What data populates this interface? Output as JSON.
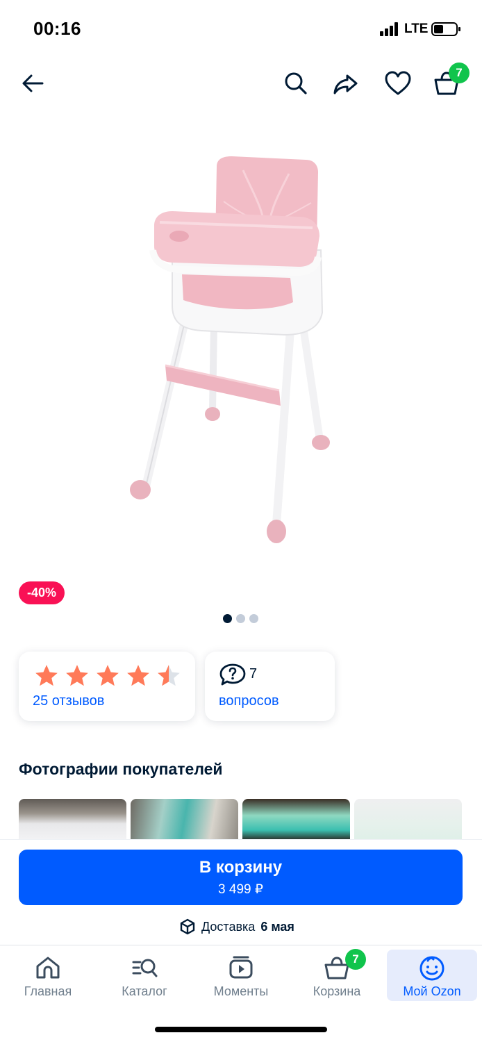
{
  "status_bar": {
    "time": "00:16",
    "network": "LTE"
  },
  "header": {
    "icons": [
      "back-arrow-icon",
      "search-icon",
      "share-icon",
      "heart-icon",
      "basket-icon"
    ],
    "cart_count": "7"
  },
  "product": {
    "image_subject": "pink baby high chair",
    "discount": "-40%",
    "gallery_total": 3,
    "gallery_active": 1
  },
  "rating_card": {
    "stars_filled": 4.5,
    "stars_max": 5,
    "star_color": "#ff7a59",
    "reviews_link": "25 отзывов"
  },
  "questions_card": {
    "count": "7",
    "link": "вопросов"
  },
  "customer_photos": {
    "title": "Фотографии покупателей",
    "count_visible": 4
  },
  "buy_panel": {
    "button_label": "В корзину",
    "price": "3 499 ₽",
    "delivery_prefix": "Доставка",
    "delivery_date": "6 мая"
  },
  "tab_bar": {
    "tabs": [
      {
        "label": "Главная",
        "icon": "home-icon"
      },
      {
        "label": "Каталог",
        "icon": "catalog-icon"
      },
      {
        "label": "Моменты",
        "icon": "moments-icon"
      },
      {
        "label": "Корзина",
        "icon": "basket-icon"
      },
      {
        "label": "Мой Ozon",
        "icon": "smiley-icon"
      }
    ],
    "active_index": 4,
    "cart_badge": "7"
  },
  "colors": {
    "accent": "#005bff",
    "discount": "#f91155",
    "badge": "#10c44c",
    "text": "#001a34"
  }
}
